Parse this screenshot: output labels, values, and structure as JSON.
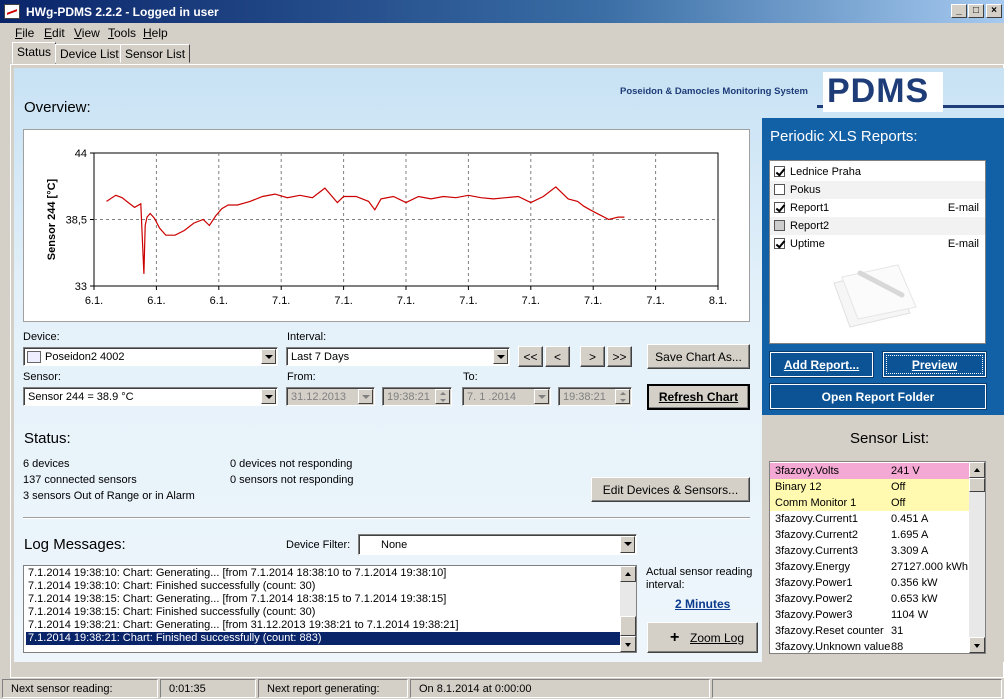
{
  "window": {
    "title": "HWg-PDMS 2.2.2 - Logged in user"
  },
  "menu": [
    "File",
    "Edit",
    "View",
    "Tools",
    "Help"
  ],
  "tabs": [
    {
      "label": "Status",
      "active": true
    },
    {
      "label": "Device List",
      "active": false
    },
    {
      "label": "Sensor List",
      "active": false
    }
  ],
  "brand": {
    "subtitle": "Poseidon & Damocles Monitoring System",
    "logo": "PDMS"
  },
  "overview": {
    "title": "Overview:"
  },
  "chart_data": {
    "type": "line",
    "title": "",
    "xlabel": "",
    "ylabel": "Sensor 244 [°C]",
    "ylim": [
      33,
      44
    ],
    "yticks": [
      "44",
      "38,5",
      "33"
    ],
    "xticks": [
      "6.1.",
      "6.1.",
      "6.1.",
      "7.1.",
      "7.1.",
      "7.1.",
      "7.1.",
      "7.1.",
      "7.1.",
      "7.1.",
      "8.1."
    ],
    "grid": true,
    "series": [
      {
        "color": "#cc0000",
        "x": [
          0.2,
          0.35,
          0.45,
          0.55,
          0.65,
          0.75,
          0.8,
          0.82,
          0.85,
          0.9,
          0.97,
          1.05,
          1.15,
          1.3,
          1.45,
          1.6,
          1.75,
          1.85,
          1.95,
          2.05,
          2.15,
          2.3,
          2.5,
          2.7,
          2.9,
          3.1,
          3.3,
          3.5,
          3.7,
          3.9,
          4.0,
          4.2,
          4.4,
          4.5,
          4.6,
          4.8,
          5.0,
          5.2,
          5.4,
          5.6,
          5.8,
          6.0,
          6.2,
          6.4,
          6.6,
          6.8,
          7.0,
          7.2,
          7.4,
          7.6,
          7.75,
          7.85,
          7.95,
          8.1,
          8.25,
          8.4,
          8.5
        ],
        "y": [
          40.0,
          40.5,
          40.3,
          39.9,
          39.5,
          39.8,
          34.0,
          38.0,
          38.7,
          39.0,
          38.6,
          37.8,
          37.2,
          37.2,
          37.6,
          38.2,
          38.5,
          38.0,
          38.8,
          39.4,
          39.7,
          39.7,
          40.0,
          40.4,
          40.6,
          40.3,
          40.5,
          40.3,
          41.1,
          39.9,
          40.4,
          40.4,
          40.0,
          39.3,
          40.2,
          40.4,
          39.9,
          40.4,
          40.2,
          40.4,
          40.3,
          40.5,
          40.3,
          40.2,
          40.3,
          40.4,
          39.9,
          40.4,
          41.2,
          40.2,
          40.0,
          39.6,
          39.3,
          38.9,
          38.5,
          38.7,
          38.7
        ]
      }
    ]
  },
  "controls": {
    "device_label": "Device:",
    "device_value": "Poseidon2 4002",
    "interval_label": "Interval:",
    "interval_value": "Last 7 Days",
    "sensor_label": "Sensor:",
    "sensor_value": "Sensor 244 = 38.9 °C",
    "from_label": "From:",
    "from_date": "31.12.2013",
    "from_time": "19:38:21",
    "to_label": "To:",
    "to_date": "7. 1 .2014",
    "to_time": "19:38:21",
    "nav_first": "<<",
    "nav_prev": "<",
    "nav_next": ">",
    "nav_last": ">>",
    "save_chart": "Save Chart As...",
    "refresh_chart": "Refresh Chart"
  },
  "xls": {
    "title": "Periodic XLS Reports:",
    "items": [
      {
        "name": "Lednice Praha",
        "checked": true,
        "mode": ""
      },
      {
        "name": "Pokus",
        "checked": false,
        "mode": ""
      },
      {
        "name": "Report1",
        "checked": true,
        "mode": "E-mail"
      },
      {
        "name": "Report2",
        "checked": false,
        "mode": ""
      },
      {
        "name": "Uptime",
        "checked": true,
        "mode": "E-mail"
      }
    ],
    "add_report": "Add Report...",
    "preview": "Preview",
    "open_folder": "Open Report Folder"
  },
  "status": {
    "title": "Status:",
    "devices": "6 devices",
    "connected": "137 connected sensors",
    "alarm": "3 sensors Out of Range or in Alarm",
    "not_resp_devices": "0 devices not responding",
    "not_resp_sensors": "0 sensors not responding",
    "edit_button": "Edit Devices & Sensors..."
  },
  "log": {
    "title": "Log Messages:",
    "filter_label": "Device Filter:",
    "filter_value": "None",
    "lines": [
      "7.1.2014 19:38:10: Chart: Generating... [from 7.1.2014 18:38:10 to 7.1.2014 19:38:10]",
      "7.1.2014 19:38:10: Chart: Finished successfully (count: 30)",
      "7.1.2014 19:38:15: Chart: Generating... [from 7.1.2014 18:38:15 to 7.1.2014 19:38:15]",
      "7.1.2014 19:38:15: Chart: Finished successfully (count: 30)",
      "7.1.2014 19:38:21: Chart: Generating... [from 31.12.2013 19:38:21 to 7.1.2014 19:38:21]",
      "7.1.2014 19:38:21: Chart: Finished successfully (count: 883)"
    ],
    "reading_label_1": "Actual sensor reading",
    "reading_label_2": "interval:",
    "reading_value": "2 Minutes",
    "zoom": "Zoom Log"
  },
  "sensor_list": {
    "title": "Sensor List:",
    "rows": [
      {
        "name": "3fazovy.Volts",
        "value": "241 V",
        "state": "alarm"
      },
      {
        "name": "Binary 12",
        "value": "Off",
        "state": "warn"
      },
      {
        "name": "Comm Monitor 1",
        "value": "Off",
        "state": "warn"
      },
      {
        "name": "3fazovy.Current1",
        "value": "0.451 A",
        "state": ""
      },
      {
        "name": "3fazovy.Current2",
        "value": "1.695 A",
        "state": ""
      },
      {
        "name": "3fazovy.Current3",
        "value": "3.309 A",
        "state": ""
      },
      {
        "name": "3fazovy.Energy",
        "value": "27127.000 kWh",
        "state": ""
      },
      {
        "name": "3fazovy.Power1",
        "value": "0.356 kW",
        "state": ""
      },
      {
        "name": "3fazovy.Power2",
        "value": "0.653 kW",
        "state": ""
      },
      {
        "name": "3fazovy.Power3",
        "value": "1104 W",
        "state": ""
      },
      {
        "name": "3fazovy.Reset counter",
        "value": "31",
        "state": ""
      },
      {
        "name": "3fazovy.Unknown value",
        "value": "88",
        "state": ""
      }
    ]
  },
  "statusbar": {
    "next_reading_label": "Next sensor reading:",
    "next_reading_value": "0:01:35",
    "next_report_label": "Next report generating:",
    "next_report_value": "On 8.1.2014 at 0:00:00"
  },
  "colors": {
    "accent": "#1260a5",
    "chart_line": "#cc0000",
    "alarm": "#f4a8d4",
    "warn": "#fffab0",
    "selection": "#0a246a"
  }
}
